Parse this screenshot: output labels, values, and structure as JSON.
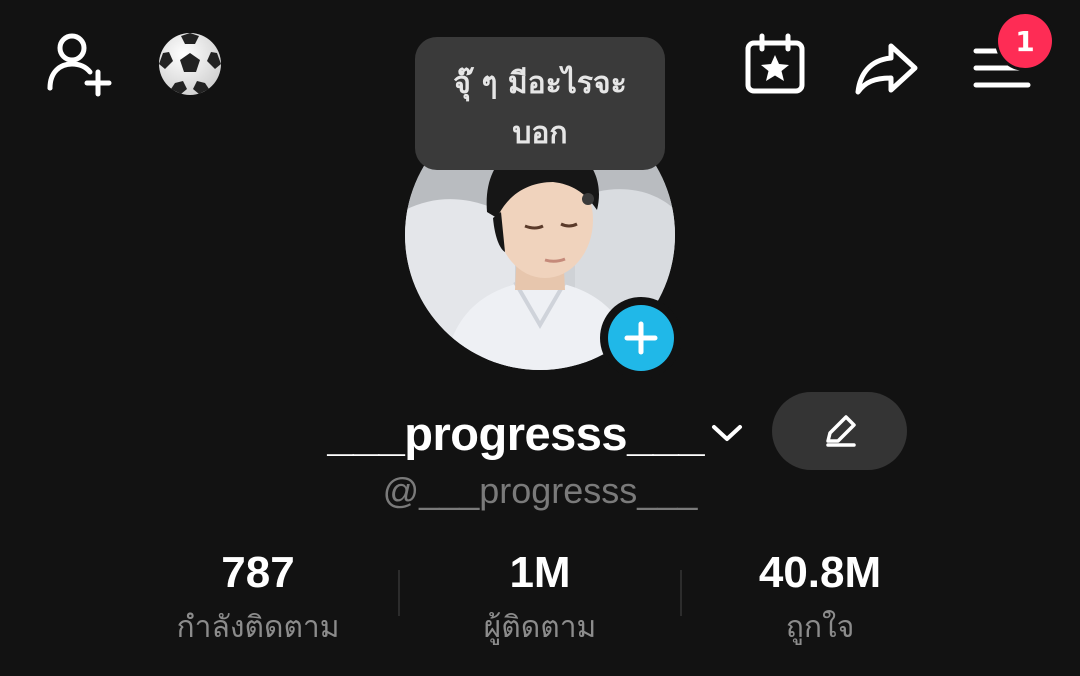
{
  "header": {
    "icons": {
      "add_friend": "add-friend-icon",
      "soccer": "soccer-ball-icon",
      "calendar": "calendar-star-icon",
      "share": "share-arrow-icon",
      "menu": "menu-icon"
    },
    "notification_count": "1"
  },
  "profile": {
    "bio_bubble": "จุ๊ ๆ มีอะไรจะ\nบอก",
    "username": "___progresss___",
    "handle": "@___progresss___",
    "edit_icon": "pencil-icon"
  },
  "stats": [
    {
      "value": "787",
      "label": "กำลังติดตาม"
    },
    {
      "value": "1M",
      "label": "ผู้ติดตาม"
    },
    {
      "value": "40.8M",
      "label": "ถูกใจ"
    }
  ],
  "colors": {
    "background": "#121212",
    "badge": "#fe2c55",
    "add_avatar": "#20b8e8",
    "secondary_text": "#8c8c8c"
  }
}
